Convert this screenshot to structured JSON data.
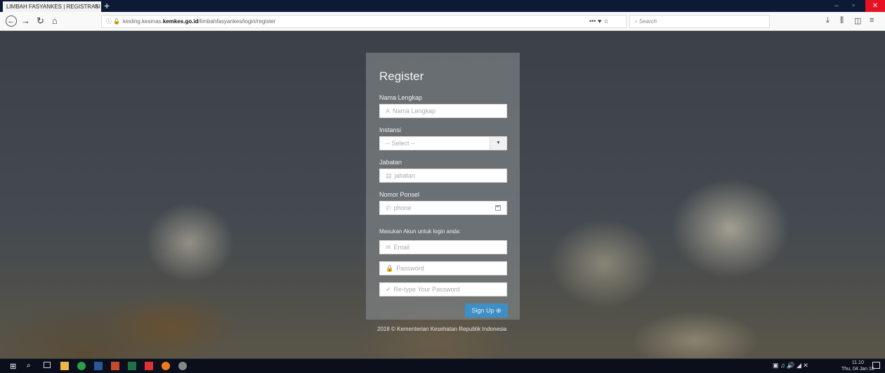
{
  "browser": {
    "tab_title": "LIMBAH FASYANKES | REGISTRASI",
    "tab_close": "×",
    "new_tab": "+",
    "window_controls": {
      "minimize": "–",
      "maximize": "▫",
      "close": "✕"
    },
    "url_prefix": "kesling.kesmas.",
    "url_domain": "kemkes.go.id",
    "url_path": "/limbahfasyankes/login/register",
    "url_actions": "•••  ♥  ☆",
    "search_placeholder": "Search"
  },
  "form": {
    "title": "Register",
    "fields": [
      {
        "label": "Nama Lengkap",
        "placeholder": "Nama Lengkap",
        "icon": "text-icon"
      },
      {
        "label": "Instansi",
        "placeholder": "-- Select --",
        "icon": "chevron-down-icon"
      },
      {
        "label": "Jabatan",
        "placeholder": "jabatan",
        "icon": "card-icon"
      },
      {
        "label": "Nomor Ponsel",
        "placeholder": "phone",
        "icon": "phone-icon"
      }
    ],
    "account_note": "Masukan Akun untuk login anda:",
    "account_fields": [
      {
        "placeholder": "Email",
        "icon": "envelope-icon"
      },
      {
        "placeholder": "Password",
        "icon": "lock-icon"
      },
      {
        "placeholder": "Re-type Your Password",
        "icon": "check-icon"
      }
    ],
    "submit_label": "Sign Up ⊕"
  },
  "footer": "2018 © Kementerian Kesehatan Republik Indonesia",
  "taskbar": {
    "time": "11.10",
    "date": "Thu, 04 Jan 18"
  }
}
